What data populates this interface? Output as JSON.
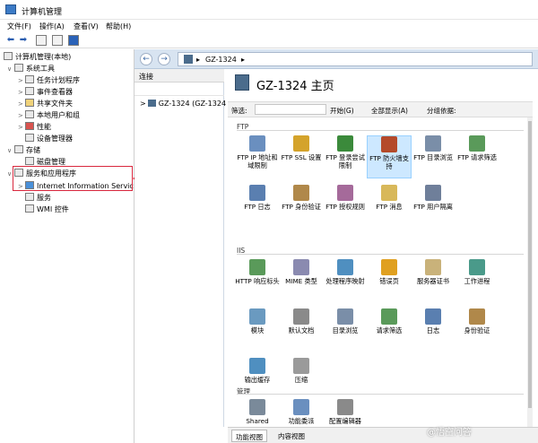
{
  "window": {
    "title": "计算机管理"
  },
  "menu": [
    "文件(F)",
    "操作(A)",
    "查看(V)",
    "帮助(H)"
  ],
  "tree": {
    "root": "计算机管理(本地)",
    "items": [
      {
        "label": "系统工具",
        "level": 1,
        "expanded": true
      },
      {
        "label": "任务计划程序",
        "level": 2
      },
      {
        "label": "事件查看器",
        "level": 2
      },
      {
        "label": "共享文件夹",
        "level": 2
      },
      {
        "label": "本地用户和组",
        "level": 2
      },
      {
        "label": "性能",
        "level": 2
      },
      {
        "label": "设备管理器",
        "level": 2
      },
      {
        "label": "存储",
        "level": 1,
        "expanded": true
      },
      {
        "label": "磁盘管理",
        "level": 2
      },
      {
        "label": "服务和应用程序",
        "level": 1,
        "expanded": true
      },
      {
        "label": "Internet Information Servic",
        "level": 2
      },
      {
        "label": "服务",
        "level": 2
      },
      {
        "label": "WMI 控件",
        "level": 2
      }
    ]
  },
  "iis": {
    "breadcrumb": [
      "GZ-1324",
      "▸"
    ],
    "connections_header": "连接",
    "server_node": "GZ-1324 (GZ-1324",
    "home_title": "GZ-1324 主页",
    "filter": {
      "label": "筛选:",
      "start": "开始(G)",
      "show_all": "全部显示(A)",
      "group_by": "分组依据:"
    },
    "groups": [
      {
        "name": "FTP",
        "features": [
          {
            "label": "FTP IP 地址和域限制",
            "icon": "ftp-ip-icon",
            "color": "#6a8fbf"
          },
          {
            "label": "FTP SSL 设置",
            "icon": "ftp-ssl-icon",
            "color": "#d4a32b"
          },
          {
            "label": "FTP 登录尝试限制",
            "icon": "ftp-logon-icon",
            "color": "#3b8a3b"
          },
          {
            "label": "FTP 防火墙支持",
            "icon": "ftp-firewall-icon",
            "color": "#b44a2a",
            "selected": true
          },
          {
            "label": "FTP 目录浏览",
            "icon": "ftp-dir-icon",
            "color": "#7a8ea8"
          },
          {
            "label": "FTP 请求筛选",
            "icon": "ftp-request-icon",
            "color": "#5a9a5a"
          },
          {
            "label": "FTP 日志",
            "icon": "ftp-log-icon",
            "color": "#5a7fb0"
          },
          {
            "label": "FTP 身份验证",
            "icon": "ftp-auth-icon",
            "color": "#b0884a"
          },
          {
            "label": "FTP 授权规则",
            "icon": "ftp-authz-icon",
            "color": "#a56a9a"
          },
          {
            "label": "FTP 消息",
            "icon": "ftp-message-icon",
            "color": "#d8b85a"
          },
          {
            "label": "FTP 用户隔离",
            "icon": "ftp-isolation-icon",
            "color": "#6f7f9a"
          }
        ]
      },
      {
        "name": "IIS",
        "features": [
          {
            "label": "HTTP 响应标头",
            "icon": "http-headers-icon",
            "color": "#5a9a5a"
          },
          {
            "label": "MIME 类型",
            "icon": "mime-icon",
            "color": "#8a8ab0"
          },
          {
            "label": "处理程序映射",
            "icon": "handler-icon",
            "color": "#4f8fc0"
          },
          {
            "label": "错误页",
            "icon": "error-page-icon",
            "color": "#e0a020"
          },
          {
            "label": "服务器证书",
            "icon": "certificate-icon",
            "color": "#c9b27a"
          },
          {
            "label": "工作进程",
            "icon": "worker-icon",
            "color": "#4a9a8a"
          },
          {
            "label": "模块",
            "icon": "modules-icon",
            "color": "#6a9ac0"
          },
          {
            "label": "默认文档",
            "icon": "default-doc-icon",
            "color": "#8a8a8a"
          },
          {
            "label": "目录浏览",
            "icon": "dir-browse-icon",
            "color": "#7a8ea8"
          },
          {
            "label": "请求筛选",
            "icon": "request-filter-icon",
            "color": "#5a9a5a"
          },
          {
            "label": "日志",
            "icon": "log-icon",
            "color": "#5a7fb0"
          },
          {
            "label": "身份验证",
            "icon": "auth-icon",
            "color": "#b0884a"
          },
          {
            "label": "输出缓存",
            "icon": "output-cache-icon",
            "color": "#4f8fc0"
          },
          {
            "label": "压缩",
            "icon": "compression-icon",
            "color": "#9a9a9a"
          }
        ]
      },
      {
        "name": "管理",
        "features": [
          {
            "label": "Shared",
            "icon": "shared-config-icon",
            "color": "#7a8a9a"
          },
          {
            "label": "功能委派",
            "icon": "delegation-icon",
            "color": "#6a8fbf"
          },
          {
            "label": "配置编辑器",
            "icon": "config-editor-icon",
            "color": "#8a8a8a"
          }
        ]
      }
    ],
    "bottom_tabs": [
      "功能视图",
      "内容视图"
    ]
  },
  "watermark": "@悟空问答"
}
